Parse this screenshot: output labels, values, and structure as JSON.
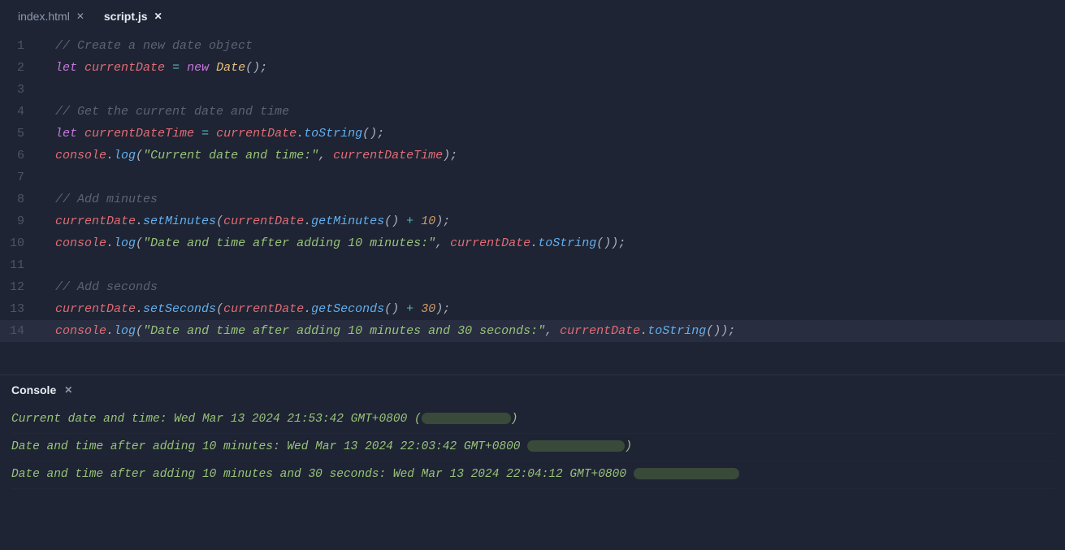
{
  "tabs": [
    {
      "label": "index.html",
      "active": false
    },
    {
      "label": "script.js",
      "active": true
    }
  ],
  "lines": {
    "l1": "// Create a new date object",
    "l4": "// Get the current date and time",
    "l8": "// Add minutes",
    "l12": "// Add seconds",
    "kw_let": "let",
    "kw_new": "new",
    "var_currentDate": "currentDate",
    "var_currentDateTime": "currentDateTime",
    "var_console": "console",
    "fn_Date": "Date",
    "fn_toString": "toString",
    "fn_log": "log",
    "fn_setMinutes": "setMinutes",
    "fn_getMinutes": "getMinutes",
    "fn_setSeconds": "setSeconds",
    "fn_getSeconds": "getSeconds",
    "str_l6": "\"Current date and time:\"",
    "str_l10": "\"Date and time after adding 10 minutes:\"",
    "str_l14": "\"Date and time after adding 10 minutes and 30 seconds:\"",
    "num_10": "10",
    "num_30": "30",
    "eq": " = ",
    "plus": " + ",
    "dot": ".",
    "comma": ", ",
    "lp": "(",
    "rp": ")",
    "sc": ";",
    "ep": "();",
    "cp": ");",
    "ln": {
      "n1": "1",
      "n2": "2",
      "n3": "3",
      "n4": "4",
      "n5": "5",
      "n6": "6",
      "n7": "7",
      "n8": "8",
      "n9": "9",
      "n10": "10",
      "n11": "11",
      "n12": "12",
      "n13": "13",
      "n14": "14"
    }
  },
  "console": {
    "title": "Console",
    "out1": "Current date and time: Wed Mar 13 2024 21:53:42 GMT+0800 (",
    "out2": "Date and time after adding 10 minutes: Wed Mar 13 2024 22:03:42 GMT+0800 ",
    "out3": "Date and time after adding 10 minutes and 30 seconds: Wed Mar 13 2024 22:04:12 GMT+0800 "
  }
}
